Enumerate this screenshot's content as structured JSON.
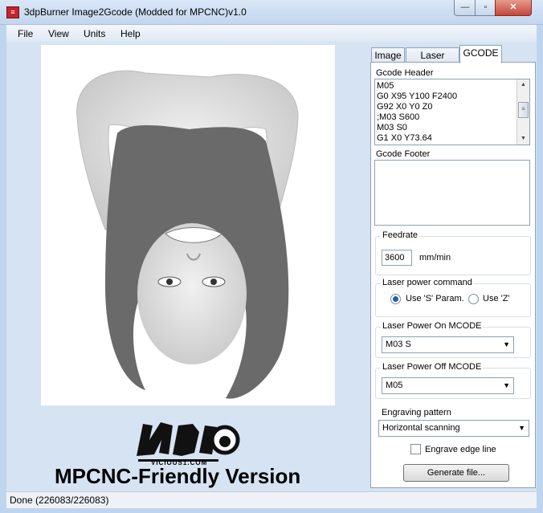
{
  "window": {
    "title": "3dpBurner Image2Gcode (Modded for MPCNC)v1.0",
    "app_icon": "app-icon",
    "controls": {
      "minimize": "—",
      "maximize": "▫",
      "close": "✕"
    }
  },
  "menu": {
    "items": [
      "File",
      "View",
      "Units",
      "Help"
    ]
  },
  "main": {
    "brand_logo_text": "VICIOUS1.COM",
    "banner": "MPCNC-Friendly Version"
  },
  "tabs": [
    {
      "label": "Image",
      "active": false
    },
    {
      "label": "Laser profile",
      "active": false
    },
    {
      "label": "GCODE",
      "active": true
    }
  ],
  "gcode": {
    "header_label": "Gcode Header",
    "header_lines": [
      "M05",
      "G0 X95 Y100 F2400",
      "G92 X0 Y0 Z0",
      ";M03 S600",
      "M03 S0",
      "G1 X0 Y73.64"
    ],
    "footer_label": "Gcode Footer",
    "footer_value": "",
    "feedrate_label": "Feedrate",
    "feedrate_value": "3600",
    "feedrate_unit": "mm/min",
    "power_cmd_label": "Laser power command",
    "power_cmd_options": [
      "Use 'S' Param.",
      "Use 'Z'"
    ],
    "power_cmd_selected": "Use 'S' Param.",
    "power_on_label": "Laser Power On MCODE",
    "power_on_value": "M03 S",
    "power_off_label": "Laser Power Off MCODE",
    "power_off_value": "M05",
    "pattern_label": "Engraving pattern",
    "pattern_value": "Horizontal scanning",
    "edge_line_label": "Engrave edge line",
    "edge_line_checked": false,
    "generate_label": "Generate file..."
  },
  "status": {
    "text": "Done (226083/226083)"
  },
  "colors": {
    "accent": "#1c5fb4",
    "close": "#c5463b",
    "client_bg": "#d6e3f2"
  }
}
